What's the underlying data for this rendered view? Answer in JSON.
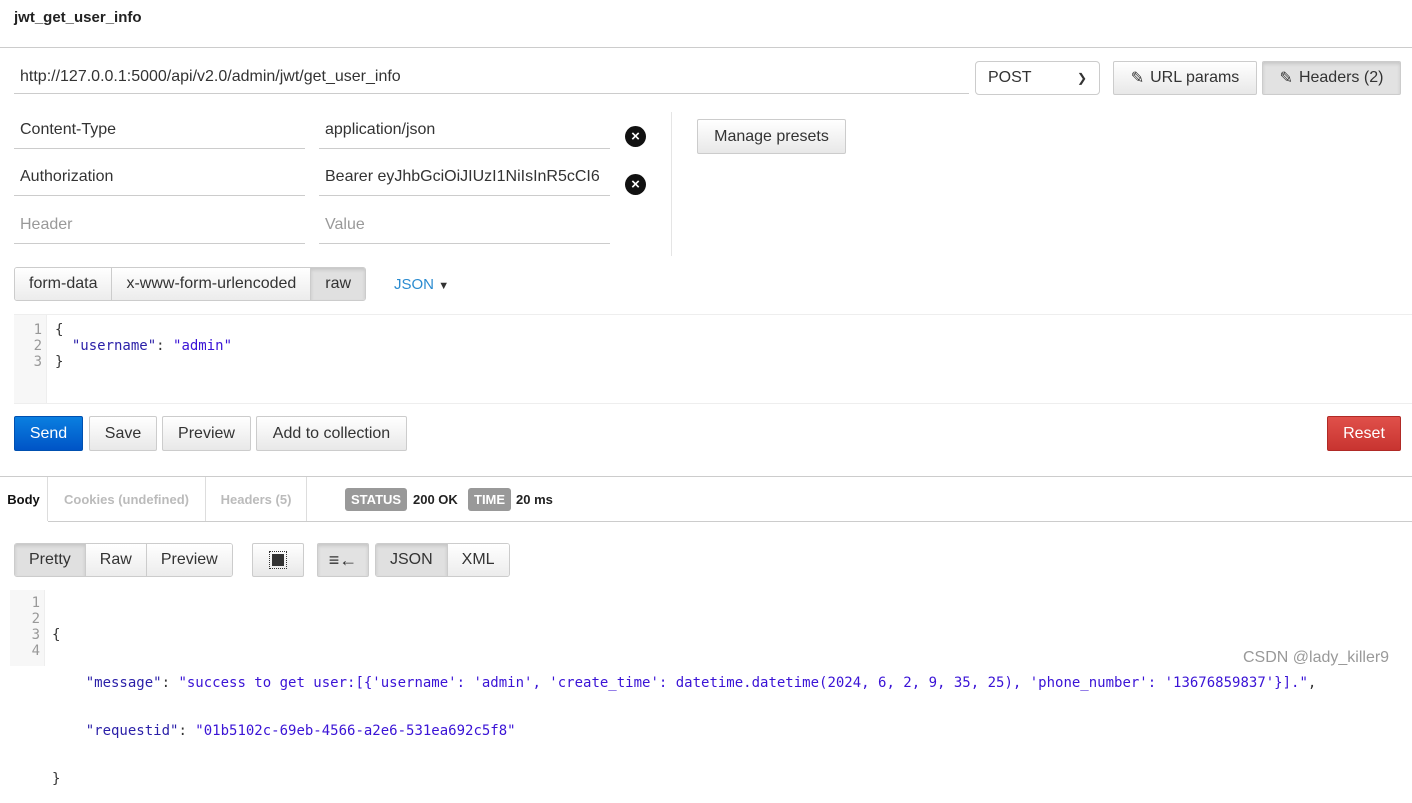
{
  "title": "jwt_get_user_info",
  "request": {
    "url": "http://127.0.0.1:5000/api/v2.0/admin/jwt/get_user_info",
    "method": "POST",
    "url_params_label": "URL params",
    "headers_label": "Headers (2)",
    "headers": [
      {
        "key": "Content-Type",
        "value": "application/json"
      },
      {
        "key": "Authorization",
        "value": "Bearer eyJhbGciOiJIUzI1NiIsInR5cCI6"
      }
    ],
    "header_placeholder": "Header",
    "value_placeholder": "Value",
    "manage_presets": "Manage presets",
    "body_modes": [
      "form-data",
      "x-www-form-urlencoded",
      "raw"
    ],
    "body_mode_active": "raw",
    "raw_type": "JSON",
    "body_lines": [
      {
        "n": "1",
        "text": "{"
      },
      {
        "n": "2",
        "key": "\"username\"",
        "value": "\"admin\""
      },
      {
        "n": "3",
        "text": "}"
      }
    ],
    "send": "Send",
    "save": "Save",
    "preview": "Preview",
    "add_to_collection": "Add to collection",
    "reset": "Reset"
  },
  "response": {
    "tabs": [
      "Body",
      "Cookies (undefined)",
      "Headers (5)"
    ],
    "status_label": "STATUS",
    "status": "200 OK",
    "time_label": "TIME",
    "time": "20 ms",
    "view_modes": [
      "Pretty",
      "Raw",
      "Preview"
    ],
    "formats": [
      "JSON",
      "XML"
    ],
    "lines": [
      {
        "n": "1",
        "text": "{"
      },
      {
        "n": "2",
        "key": "\"message\"",
        "value": "\"success to get user:[{'username': 'admin', 'create_time': datetime.datetime(2024, 6, 2, 9, 35, 25), 'phone_number': '13676859837'}].\"",
        "tail": ","
      },
      {
        "n": "3",
        "key": "\"requestid\"",
        "value": "\"01b5102c-69eb-4566-a2e6-531ea692c5f8\"",
        "tail": ""
      },
      {
        "n": "4",
        "text": "}"
      }
    ]
  },
  "watermark": "CSDN @lady_killer9",
  "colors": {
    "send": "#0a6fd6",
    "reset": "#d33a35",
    "link": "#2a8bd0"
  }
}
